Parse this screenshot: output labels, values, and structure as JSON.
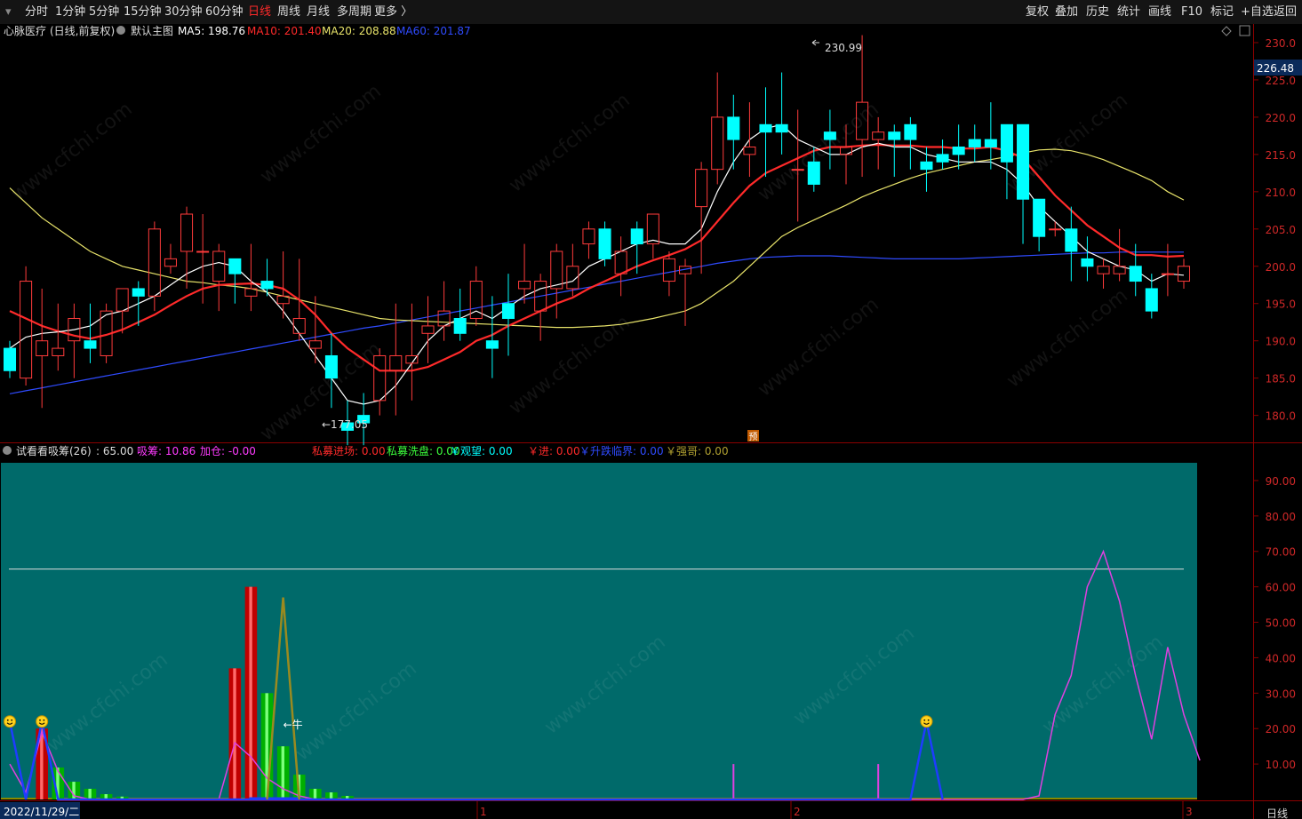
{
  "toolbar": {
    "left_items": [
      "分时",
      "1分钟",
      "5分钟",
      "15分钟",
      "30分钟",
      "60分钟",
      "日线",
      "周线",
      "月线",
      "多周期",
      "更多 〉"
    ],
    "active": "日线",
    "right_items": [
      "复权",
      "叠加",
      "历史",
      "统计",
      "画线",
      "F10",
      "标记",
      "+自选",
      "返回"
    ]
  },
  "main_panel": {
    "stock_name": "心脉医疗",
    "adjust": "(日线,前复权)",
    "template": "默认主图",
    "ma": [
      {
        "label": "MA5:",
        "value": "198.76",
        "color": "#ffffff"
      },
      {
        "label": "MA10:",
        "value": "201.40",
        "color": "#ff2a2a"
      },
      {
        "label": "MA20:",
        "value": "208.88",
        "color": "#e8e36a"
      },
      {
        "label": "MA60:",
        "value": "201.87",
        "color": "#2f4bff"
      }
    ],
    "current_price_tag": "226.48",
    "y_ticks": [
      "230.0",
      "225.0",
      "220.0",
      "215.0",
      "210.0",
      "205.0",
      "200.0",
      "195.0",
      "190.0",
      "185.0",
      "180.0"
    ],
    "high_label": "230.99",
    "low_label": "177.05",
    "marker_label": "预"
  },
  "sub_panel": {
    "title": "试看看吸筹(26)",
    "ref_value": ": 65.00",
    "legend": [
      {
        "label": "吸筹:",
        "value": "10.86",
        "color": "#ff3bff"
      },
      {
        "label": "加仓:",
        "value": "-0.00",
        "color": "#ff3bff"
      },
      {
        "label": "私募进场:",
        "value": "0.00",
        "color": "#ff2a2a"
      },
      {
        "label": "私募洗盘:",
        "value": "0.00",
        "color": "#3cff3c"
      },
      {
        "label": "￥观望:",
        "value": "0.00",
        "color": "#00ffff"
      },
      {
        "label": "￥进:",
        "value": "0.00",
        "color": "#ff2a2a"
      },
      {
        "label": "￥升跌临界:",
        "value": "0.00",
        "color": "#2f4bff"
      },
      {
        "label": "￥强哥:",
        "value": "0.00",
        "color": "#b0a030"
      }
    ],
    "y_ticks": [
      "90.00",
      "80.00",
      "70.00",
      "60.00",
      "50.00",
      "40.00",
      "30.00",
      "20.00",
      "10.00"
    ],
    "cow_label": "←牛"
  },
  "x_axis": {
    "date_label": "2022/11/29/二",
    "month_marks": [
      "1",
      "2",
      "3"
    ],
    "period_label": "日线"
  },
  "watermark": "www.cfchi.com",
  "colors": {
    "up": "#ff3b3b",
    "down": "#00ffff",
    "sub_bg": "#006a6a",
    "grid": "#8b0000"
  },
  "chart_data": [
    {
      "type": "candlestick",
      "title": "心脉医疗 (日线,前复权)",
      "ylim": [
        176.5,
        232.5
      ],
      "ohlc": [
        [
          189,
          190,
          185,
          186
        ],
        [
          185,
          200,
          184,
          198
        ],
        [
          188,
          197,
          181,
          190
        ],
        [
          188,
          195,
          186,
          189
        ],
        [
          190,
          195,
          185,
          193
        ],
        [
          190,
          195,
          187,
          189
        ],
        [
          188,
          195,
          187,
          194
        ],
        [
          194,
          197,
          191,
          197
        ],
        [
          197,
          198,
          192,
          196
        ],
        [
          196,
          206,
          194,
          205
        ],
        [
          200,
          203,
          199,
          201
        ],
        [
          202,
          208,
          197,
          207
        ],
        [
          202,
          207,
          195,
          202
        ],
        [
          198,
          203,
          194,
          202
        ],
        [
          201,
          200,
          195,
          199
        ],
        [
          196,
          203,
          194,
          197
        ],
        [
          198,
          201,
          196,
          197
        ],
        [
          195,
          202,
          193,
          196
        ],
        [
          191,
          201,
          190,
          193
        ],
        [
          189,
          196,
          187,
          190
        ],
        [
          188,
          191,
          181,
          185
        ],
        [
          179,
          182,
          176,
          178
        ],
        [
          180,
          183,
          176,
          179
        ],
        [
          182,
          189,
          180,
          188
        ],
        [
          186,
          195,
          180,
          188
        ],
        [
          187,
          195,
          182,
          188
        ],
        [
          191,
          196,
          187,
          192
        ],
        [
          192,
          198,
          190,
          194
        ],
        [
          193,
          197,
          190,
          191
        ],
        [
          193,
          200,
          192,
          198
        ],
        [
          190,
          196,
          185,
          189
        ],
        [
          195,
          199,
          188,
          193
        ],
        [
          197,
          203,
          195,
          198
        ],
        [
          194,
          199,
          190,
          198
        ],
        [
          197,
          203,
          193,
          202
        ],
        [
          197,
          203,
          196,
          200
        ],
        [
          203,
          206,
          201,
          205
        ],
        [
          205,
          206,
          200,
          201
        ],
        [
          199,
          204,
          196,
          202
        ],
        [
          205,
          206,
          199,
          203
        ],
        [
          203,
          207,
          201,
          207
        ],
        [
          198,
          202,
          196,
          201
        ],
        [
          199,
          201,
          192,
          200
        ],
        [
          208,
          214,
          199,
          213
        ],
        [
          213,
          226,
          211,
          220
        ],
        [
          220,
          223,
          213,
          217
        ],
        [
          215,
          222,
          212,
          216
        ],
        [
          219,
          224,
          212,
          218
        ],
        [
          219,
          226,
          215,
          218
        ],
        [
          213,
          221,
          206,
          213
        ],
        [
          214,
          216,
          210,
          211
        ],
        [
          218,
          221,
          213,
          217
        ],
        [
          215,
          219,
          211,
          216
        ],
        [
          217,
          231,
          212,
          222
        ],
        [
          217,
          220,
          213,
          218
        ],
        [
          218,
          219,
          212,
          217
        ],
        [
          219,
          220,
          213,
          217
        ],
        [
          214,
          216,
          210,
          213
        ],
        [
          215,
          217,
          213,
          214
        ],
        [
          216,
          219,
          213,
          215
        ],
        [
          217,
          219,
          214,
          216
        ],
        [
          217,
          222,
          213,
          216
        ],
        [
          219,
          218,
          209,
          214
        ],
        [
          219,
          215,
          203,
          209
        ],
        [
          209,
          206,
          202,
          204
        ],
        [
          205,
          206,
          204,
          205
        ],
        [
          205,
          208,
          198,
          202
        ],
        [
          201,
          204,
          198,
          200
        ],
        [
          199,
          201,
          197,
          200
        ],
        [
          199,
          205,
          198,
          200
        ],
        [
          200,
          203,
          196,
          198
        ],
        [
          197,
          199,
          193,
          194
        ],
        [
          199,
          203,
          196,
          199
        ],
        [
          198,
          201,
          197,
          200
        ]
      ],
      "ma5": [
        189,
        190.5,
        191,
        191.2,
        191.5,
        192,
        193.5,
        194,
        195,
        196,
        197.5,
        199,
        200,
        200.5,
        200,
        198,
        196.5,
        194,
        191,
        188,
        185,
        182,
        181.5,
        182,
        184,
        187,
        190,
        192,
        193,
        194,
        193,
        194.5,
        196,
        197,
        197.5,
        198,
        200,
        201,
        202,
        203,
        203.5,
        203,
        203,
        205,
        210,
        214,
        217,
        218.5,
        219,
        217,
        216,
        215,
        215,
        216,
        216.5,
        216,
        216,
        215,
        214.5,
        214,
        214,
        214,
        213,
        211,
        208,
        206,
        204,
        202,
        201,
        200,
        199.5,
        198,
        199,
        198.8
      ],
      "ma10": [
        194,
        193,
        192,
        191.3,
        190.7,
        190.3,
        190.8,
        191.5,
        192.5,
        193.5,
        194.8,
        196,
        197,
        197.5,
        197.6,
        197.7,
        197.5,
        197,
        195.5,
        193.5,
        191,
        189,
        187.5,
        186,
        186,
        186,
        186.5,
        187.5,
        188.5,
        190,
        190.8,
        192,
        193,
        194,
        195,
        195.8,
        197,
        198,
        199,
        200,
        200.8,
        201.5,
        202.3,
        203.5,
        206,
        208.5,
        210.8,
        212.5,
        213.5,
        214.5,
        215.5,
        216,
        216,
        216.2,
        216.3,
        216.2,
        216.2,
        216,
        216,
        215.8,
        215.8,
        216,
        215.5,
        214.5,
        212,
        209.5,
        207.5,
        205.5,
        204,
        202.5,
        201.5,
        201.5,
        201.3,
        201.4
      ],
      "ma20": [
        210.5,
        208.5,
        206.5,
        205,
        203.5,
        202,
        201,
        200,
        199.5,
        199,
        198.5,
        198,
        197.8,
        197.5,
        197.3,
        197,
        196.5,
        196,
        195.5,
        195,
        194.5,
        194,
        193.5,
        193,
        192.8,
        192.7,
        192.6,
        192.5,
        192.4,
        192.3,
        192.2,
        192.1,
        192,
        191.9,
        191.8,
        191.8,
        191.9,
        192,
        192.2,
        192.6,
        193,
        193.5,
        194,
        195,
        196.5,
        198,
        200,
        202,
        204,
        205.2,
        206.2,
        207.2,
        208.2,
        209.3,
        210.2,
        211,
        211.8,
        212.5,
        213,
        213.5,
        214,
        214.3,
        214.7,
        215.2,
        215.6,
        215.7,
        215.5,
        215,
        214.3,
        213.4,
        212.5,
        211.5,
        210,
        208.9
      ],
      "ma60": [
        182.9,
        183.3,
        183.7,
        184.1,
        184.5,
        184.9,
        185.3,
        185.7,
        186.1,
        186.5,
        186.9,
        187.3,
        187.7,
        188.1,
        188.5,
        188.9,
        189.3,
        189.7,
        190.1,
        190.5,
        190.9,
        191.3,
        191.7,
        192,
        192.4,
        192.8,
        193.2,
        193.6,
        194,
        194.4,
        194.8,
        195.2,
        195.6,
        196,
        196.4,
        196.8,
        197.2,
        197.6,
        198,
        198.4,
        198.8,
        199.2,
        199.6,
        200,
        200.4,
        200.7,
        201,
        201.2,
        201.3,
        201.4,
        201.4,
        201.4,
        201.3,
        201.2,
        201.1,
        201,
        201,
        201,
        201,
        201,
        201.1,
        201.2,
        201.3,
        201.4,
        201.5,
        201.6,
        201.7,
        201.8,
        201.8,
        201.9,
        201.9,
        201.9,
        201.9,
        201.9
      ]
    },
    {
      "type": "bar",
      "title": "试看看吸筹(26)",
      "ylim": [
        0,
        95
      ],
      "reference_line": 65,
      "red_bars": [
        [
          2,
          20
        ],
        [
          14,
          37
        ],
        [
          15,
          60
        ]
      ],
      "green_bars": [
        [
          3,
          9
        ],
        [
          4,
          5
        ],
        [
          5,
          3
        ],
        [
          6,
          1.5
        ],
        [
          7,
          0.8
        ],
        [
          16,
          30
        ],
        [
          17,
          15
        ],
        [
          18,
          7
        ],
        [
          19,
          3
        ],
        [
          20,
          2
        ],
        [
          21,
          1
        ]
      ],
      "magenta_line": [
        10,
        2,
        19,
        8,
        1,
        0,
        0,
        0,
        0,
        0,
        0,
        0,
        0,
        0,
        16,
        12,
        6,
        3,
        1,
        0,
        0,
        0,
        0,
        0,
        0,
        0,
        0,
        0,
        0,
        0,
        0,
        0,
        0,
        0,
        0,
        0,
        0,
        0,
        0,
        0,
        0,
        0,
        0,
        0,
        0,
        0,
        0,
        0,
        0,
        0,
        0,
        0,
        0,
        0,
        0,
        0,
        0,
        0,
        0,
        0,
        0,
        0,
        0,
        0,
        1,
        24,
        35,
        60,
        70,
        56,
        35,
        17,
        43,
        24,
        11
      ],
      "magenta_spikes": [
        [
          45,
          10
        ],
        [
          54,
          10
        ]
      ],
      "blue_line": [
        [
          0,
          22
        ],
        [
          1,
          0
        ],
        [
          2,
          22
        ],
        [
          3,
          0
        ],
        [
          56,
          0
        ],
        [
          57,
          22
        ],
        [
          58,
          0
        ]
      ],
      "olive_peak": [
        [
          16,
          0
        ],
        [
          17,
          57
        ],
        [
          18,
          0
        ]
      ],
      "smiley_points": [
        [
          0,
          22
        ],
        [
          2,
          22
        ],
        [
          57,
          22
        ]
      ]
    }
  ]
}
